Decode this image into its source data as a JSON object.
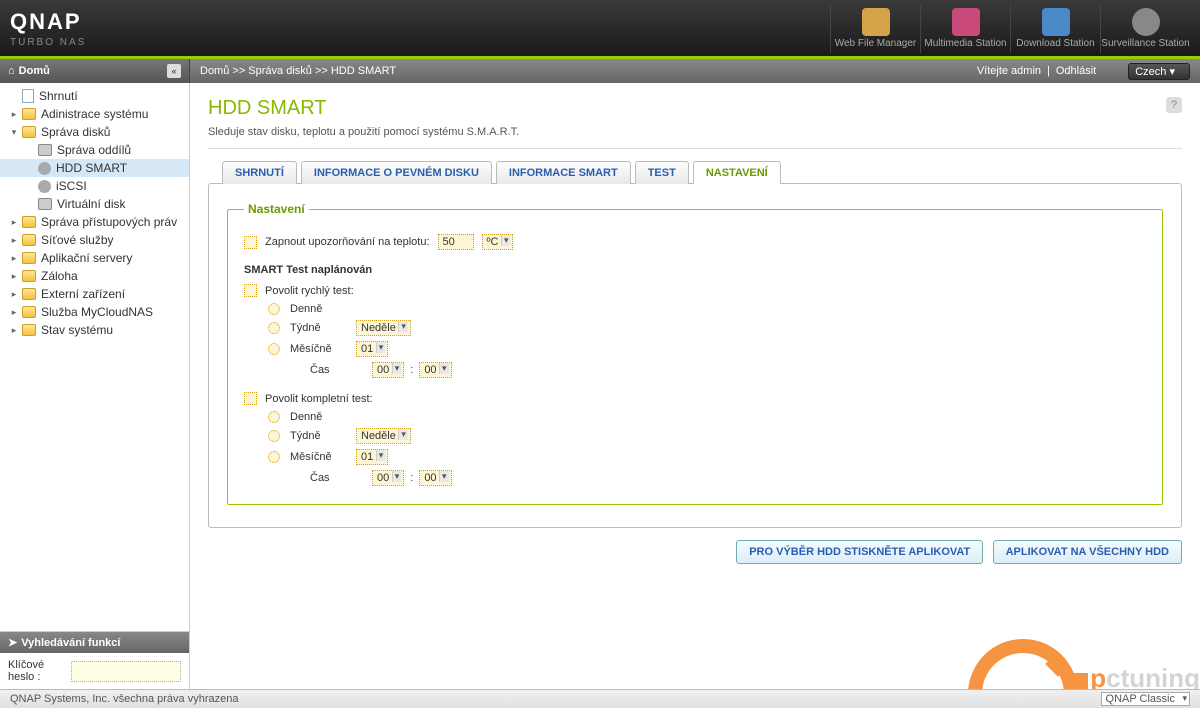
{
  "brand": {
    "name": "QNAP",
    "sub": "TURBO NAS"
  },
  "headerApps": [
    {
      "label": "Web File Manager",
      "color": "#d4a34a"
    },
    {
      "label": "Multimedia Station",
      "color": "#c94a7a"
    },
    {
      "label": "Download Station",
      "color": "#4a8ac9"
    },
    {
      "label": "Surveillance Station",
      "color": "#888"
    }
  ],
  "subheader": {
    "home": "Domů",
    "breadcrumb": "Domů >> Správa disků >> HDD SMART",
    "welcome": "Vítejte admin",
    "logout": "Odhlásit",
    "language": "Czech"
  },
  "tree": [
    {
      "label": "Shrnutí",
      "depth": 0,
      "icon": "doc"
    },
    {
      "label": "Adinistrace systému",
      "depth": 0,
      "icon": "folder",
      "toggle": "▸"
    },
    {
      "label": "Správa disků",
      "depth": 0,
      "icon": "folder-open",
      "toggle": "▾"
    },
    {
      "label": "Správa oddílů",
      "depth": 1,
      "icon": "disk"
    },
    {
      "label": "HDD SMART",
      "depth": 1,
      "icon": "gear",
      "selected": true
    },
    {
      "label": "iSCSI",
      "depth": 1,
      "icon": "gear"
    },
    {
      "label": "Virtuální disk",
      "depth": 1,
      "icon": "disk"
    },
    {
      "label": "Správa přístupových práv",
      "depth": 0,
      "icon": "folder",
      "toggle": "▸"
    },
    {
      "label": "Síťové služby",
      "depth": 0,
      "icon": "folder",
      "toggle": "▸"
    },
    {
      "label": "Aplikační servery",
      "depth": 0,
      "icon": "folder",
      "toggle": "▸"
    },
    {
      "label": "Záloha",
      "depth": 0,
      "icon": "folder",
      "toggle": "▸"
    },
    {
      "label": "Externí zařízení",
      "depth": 0,
      "icon": "folder",
      "toggle": "▸"
    },
    {
      "label": "Služba MyCloudNAS",
      "depth": 0,
      "icon": "folder",
      "toggle": "▸"
    },
    {
      "label": "Stav systému",
      "depth": 0,
      "icon": "folder",
      "toggle": "▸"
    }
  ],
  "search": {
    "title": "Vyhledávání funkcí",
    "label": "Klíčové heslo :",
    "value": ""
  },
  "page": {
    "title": "HDD SMART",
    "desc": "Sleduje stav disku, teplotu a použití pomocí systému S.M.A.R.T."
  },
  "tabs": [
    "SHRNUTÍ",
    "INFORMACE O PEVNÉM DISKU",
    "INFORMACE SMART",
    "TEST",
    "NASTAVENÍ"
  ],
  "activeTab": 4,
  "settings": {
    "legend": "Nastavení",
    "tempAlarm": {
      "label": "Zapnout upozorňování na teplotu:",
      "value": "50",
      "unit": "ºC"
    },
    "scheduledTitle": "SMART Test naplánován",
    "rapid": {
      "label": "Povolit rychlý test:",
      "daily": "Denně",
      "weekly": "Týdně",
      "weeklyVal": "Neděle",
      "monthly": "Měsíčně",
      "monthlyVal": "01",
      "timeLabel": "Čas",
      "h": "00",
      "m": "00"
    },
    "full": {
      "label": "Povolit kompletní test:",
      "daily": "Denně",
      "weekly": "Týdně",
      "weeklyVal": "Neděle",
      "monthly": "Měsíčně",
      "monthlyVal": "01",
      "timeLabel": "Čas",
      "h": "00",
      "m": "00"
    }
  },
  "buttons": {
    "selectApply": "PRO VÝBĚR HDD STISKNĚTE APLIKOVAT",
    "applyAll": "APLIKOVAT NA VŠECHNY HDD"
  },
  "footer": {
    "copyright": "QNAP Systems, Inc. všechna práva vyhrazena",
    "theme": "QNAP Classic"
  },
  "watermark": "ctuning"
}
